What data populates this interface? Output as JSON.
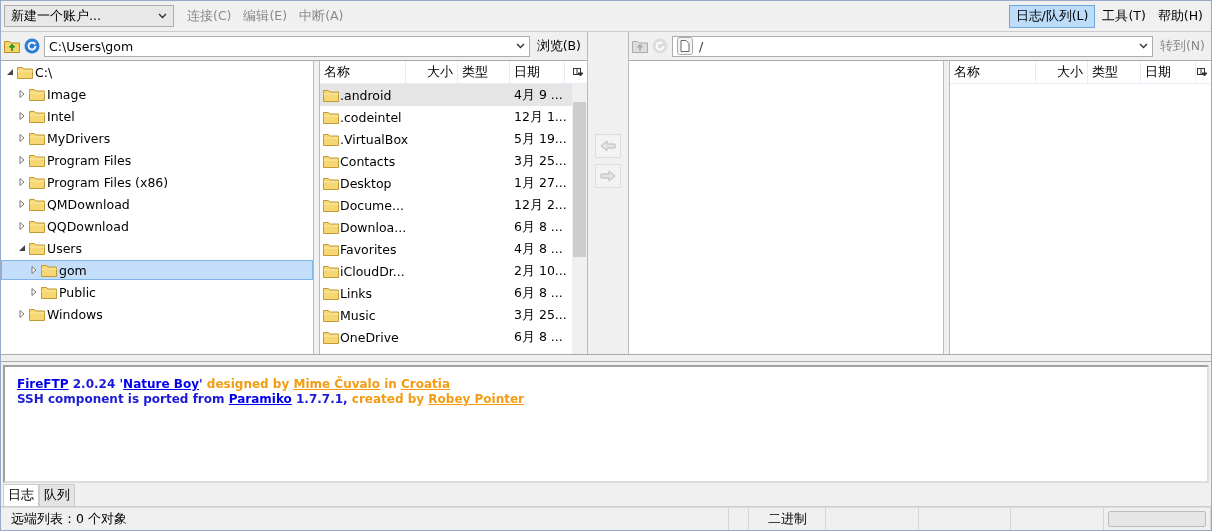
{
  "toolbar": {
    "account": {
      "value": "新建一个账户..."
    },
    "menu": [
      {
        "label": "连接(C)",
        "disabled": true
      },
      {
        "label": "编辑(E)",
        "disabled": true
      },
      {
        "label": "中断(A)",
        "disabled": true
      }
    ],
    "right_menu": [
      {
        "label": "日志/队列(L)",
        "selected": true
      },
      {
        "label": "工具(T)",
        "selected": false
      },
      {
        "label": "帮助(H)",
        "selected": false
      }
    ]
  },
  "local": {
    "path": "C:\\Users\\gom",
    "browse_button": "浏览(B)",
    "tree": [
      {
        "label": "C:\\",
        "expanded": true,
        "selected": false,
        "children": [
          {
            "label": "Image",
            "expanded": false,
            "selected": false
          },
          {
            "label": "Intel",
            "expanded": false,
            "selected": false
          },
          {
            "label": "MyDrivers",
            "expanded": false,
            "selected": false
          },
          {
            "label": "Program Files",
            "expanded": false,
            "selected": false
          },
          {
            "label": "Program Files (x86)",
            "expanded": false,
            "selected": false
          },
          {
            "label": "QMDownload",
            "expanded": false,
            "selected": false
          },
          {
            "label": "QQDownload",
            "expanded": false,
            "selected": false
          },
          {
            "label": "Users",
            "expanded": true,
            "selected": false,
            "children": [
              {
                "label": "gom",
                "expanded": false,
                "selected": true
              },
              {
                "label": "Public",
                "expanded": false,
                "selected": false
              }
            ]
          },
          {
            "label": "Windows",
            "expanded": false,
            "selected": false
          }
        ]
      }
    ],
    "columns": [
      "名称",
      "大小",
      "类型",
      "日期"
    ],
    "rows": [
      {
        "name": ".android",
        "date": "4月 9 ...",
        "selected": true
      },
      {
        "name": ".codeintel",
        "date": "12月 1...",
        "selected": false
      },
      {
        "name": ".VirtualBox",
        "date": "5月 19...",
        "selected": false
      },
      {
        "name": "Contacts",
        "date": "3月 25...",
        "selected": false
      },
      {
        "name": "Desktop",
        "date": "1月 27...",
        "selected": false
      },
      {
        "name": "Docume...",
        "date": "12月 2...",
        "selected": false
      },
      {
        "name": "Downloa...",
        "date": "6月 8 ...",
        "selected": false
      },
      {
        "name": "Favorites",
        "date": "4月 8 ...",
        "selected": false
      },
      {
        "name": "iCloudDr...",
        "date": "2月 10...",
        "selected": false
      },
      {
        "name": "Links",
        "date": "6月 8 ...",
        "selected": false
      },
      {
        "name": "Music",
        "date": "3月 25...",
        "selected": false
      },
      {
        "name": "OneDrive",
        "date": "6月 8 ...",
        "selected": false
      }
    ]
  },
  "remote": {
    "path": "/",
    "goto_button": "转到(N)",
    "columns": [
      "名称",
      "大小",
      "类型",
      "日期"
    ]
  },
  "log": [
    [
      {
        "kind": "link",
        "text": "FireFTP"
      },
      {
        "kind": "text",
        "text": " 2.0.24 '"
      },
      {
        "kind": "link",
        "text": "Nature Boy"
      },
      {
        "kind": "text",
        "text": "'"
      },
      {
        "kind": "note",
        "text": " designed by "
      },
      {
        "kind": "note-link",
        "text": "Mime Čuvalo"
      },
      {
        "kind": "note",
        "text": " in "
      },
      {
        "kind": "note-link",
        "text": "Croatia"
      }
    ],
    [
      {
        "kind": "text",
        "text": "SSH component is ported from "
      },
      {
        "kind": "link",
        "text": "Paramiko"
      },
      {
        "kind": "text",
        "text": " 1.7.7.1,"
      },
      {
        "kind": "note",
        "text": " created by "
      },
      {
        "kind": "note-link",
        "text": "Robey Pointer"
      }
    ]
  ],
  "tabs": [
    {
      "label": "日志",
      "selected": true
    },
    {
      "label": "队列",
      "selected": false
    }
  ],
  "status_bar": {
    "remote_list": "远端列表：0 个对象",
    "mode": "二进制",
    "progress": {
      "level": 0
    }
  }
}
